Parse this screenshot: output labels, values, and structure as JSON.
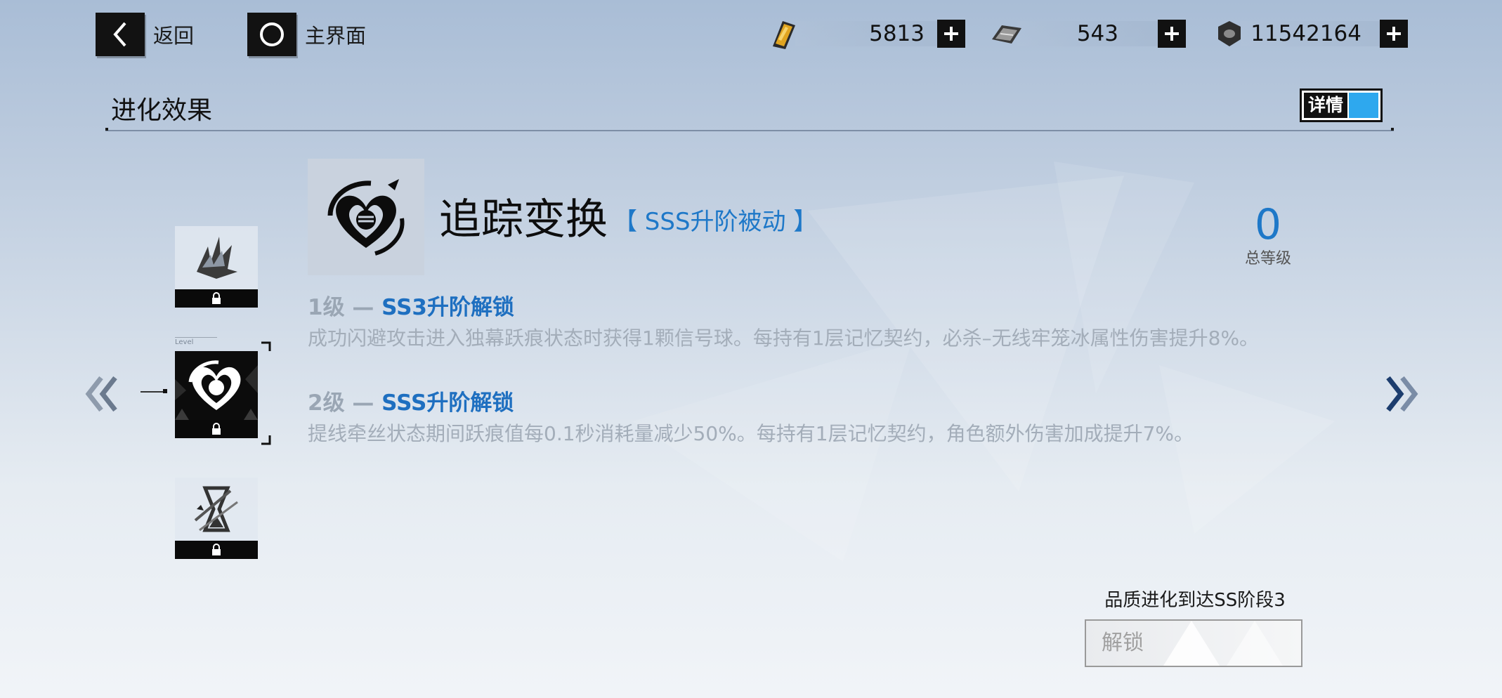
{
  "topbar": {
    "back_label": "返回",
    "home_label": "主界面"
  },
  "resources": [
    {
      "icon": "gold-card-icon",
      "value": "5813"
    },
    {
      "icon": "chip-card-icon",
      "value": "543"
    },
    {
      "icon": "nut-coin-icon",
      "value": "11542164"
    }
  ],
  "section": {
    "title": "进化效果",
    "detail_label": "详情"
  },
  "skill": {
    "name": "追踪变换",
    "tag": "【 SSS升阶被动 】",
    "level_value": "0",
    "level_caption": "总等级"
  },
  "side_list": {
    "level_marker": "Level"
  },
  "tiers": [
    {
      "num": "1级 —",
      "name": "SS3升阶解锁",
      "desc": "成功闪避攻击进入独幕跃痕状态时获得1颗信号球。每持有1层记忆契约，必杀–无线牢笼冰属性伤害提升8%。"
    },
    {
      "num": "2级 —",
      "name": "SSS升阶解锁",
      "desc": "提线牵丝状态期间跃痕值每0.1秒消耗量减少50%。每持有1层记忆契约，角色额外伤害加成提升7%。"
    }
  ],
  "requirement": {
    "text": "品质进化到达SS阶段3",
    "unlock_label": "解锁"
  },
  "colors": {
    "accent_blue": "#1e78c8",
    "toggle_blue": "#2ea8ee"
  }
}
